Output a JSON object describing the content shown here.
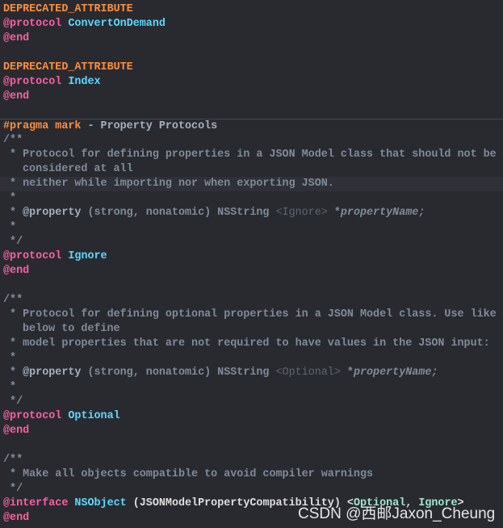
{
  "colors": {
    "background": "#292a30",
    "keyword": "#fc5fa3",
    "type": "#5dd8ff",
    "macro": "#fd8f3f",
    "comment": "#7f8c98"
  },
  "lines": [
    {
      "tokens": [
        {
          "k": "macro",
          "t": "DEPRECATED_ATTRIBUTE"
        }
      ]
    },
    {
      "tokens": [
        {
          "k": "kw",
          "t": "@protocol"
        },
        {
          "k": "plain",
          "t": " "
        },
        {
          "k": "type",
          "t": "ConvertOnDemand"
        }
      ]
    },
    {
      "tokens": [
        {
          "k": "kw",
          "t": "@end"
        }
      ]
    },
    {
      "tokens": []
    },
    {
      "tokens": [
        {
          "k": "macro",
          "t": "DEPRECATED_ATTRIBUTE"
        }
      ]
    },
    {
      "tokens": [
        {
          "k": "kw",
          "t": "@protocol"
        },
        {
          "k": "plain",
          "t": " "
        },
        {
          "k": "type",
          "t": "Index"
        }
      ]
    },
    {
      "tokens": [
        {
          "k": "kw",
          "t": "@end"
        }
      ]
    },
    {
      "tokens": []
    },
    {
      "sep": true,
      "tokens": [
        {
          "k": "macro",
          "t": "#pragma mark"
        },
        {
          "k": "cmb",
          "t": " - Property Protocols"
        }
      ]
    },
    {
      "tokens": [
        {
          "k": "cm",
          "t": "/**"
        }
      ]
    },
    {
      "tokens": [
        {
          "k": "cm",
          "t": " * Protocol for defining properties in a JSON Model class that should not be"
        }
      ]
    },
    {
      "wrap": true,
      "tokens": [
        {
          "k": "cm",
          "t": "considered at all"
        }
      ]
    },
    {
      "hl": true,
      "tokens": [
        {
          "k": "cm",
          "t": " * neither while importing nor when exporting JSON."
        }
      ]
    },
    {
      "tokens": [
        {
          "k": "cm",
          "t": " *"
        }
      ]
    },
    {
      "tokens": [
        {
          "k": "cm",
          "t": " * "
        },
        {
          "k": "cmb",
          "t": "@property"
        },
        {
          "k": "cm",
          "t": " (strong, nonatomic) NSString "
        },
        {
          "k": "tag",
          "t": "<Ignore>"
        },
        {
          "k": "cm",
          "t": " *"
        },
        {
          "k": "cmi",
          "t": "propertyName;"
        }
      ]
    },
    {
      "tokens": [
        {
          "k": "cm",
          "t": " *"
        }
      ]
    },
    {
      "tokens": [
        {
          "k": "cm",
          "t": " */"
        }
      ]
    },
    {
      "tokens": [
        {
          "k": "kw",
          "t": "@protocol"
        },
        {
          "k": "plain",
          "t": " "
        },
        {
          "k": "type",
          "t": "Ignore"
        }
      ]
    },
    {
      "tokens": [
        {
          "k": "kw",
          "t": "@end"
        }
      ]
    },
    {
      "tokens": []
    },
    {
      "tokens": [
        {
          "k": "cm",
          "t": "/**"
        }
      ]
    },
    {
      "tokens": [
        {
          "k": "cm",
          "t": " * Protocol for defining optional properties in a JSON Model class. Use like"
        }
      ]
    },
    {
      "wrap": true,
      "tokens": [
        {
          "k": "cm",
          "t": "below to define"
        }
      ]
    },
    {
      "tokens": [
        {
          "k": "cm",
          "t": " * model properties that are not required to have values in the JSON input:"
        }
      ]
    },
    {
      "tokens": [
        {
          "k": "cm",
          "t": " *"
        }
      ]
    },
    {
      "tokens": [
        {
          "k": "cm",
          "t": " * "
        },
        {
          "k": "cmb",
          "t": "@property"
        },
        {
          "k": "cm",
          "t": " (strong, nonatomic) NSString "
        },
        {
          "k": "tag",
          "t": "<Optional>"
        },
        {
          "k": "cm",
          "t": " *"
        },
        {
          "k": "cmi",
          "t": "propertyName;"
        }
      ]
    },
    {
      "tokens": [
        {
          "k": "cm",
          "t": " *"
        }
      ]
    },
    {
      "tokens": [
        {
          "k": "cm",
          "t": " */"
        }
      ]
    },
    {
      "tokens": [
        {
          "k": "kw",
          "t": "@protocol"
        },
        {
          "k": "plain",
          "t": " "
        },
        {
          "k": "type",
          "t": "Optional"
        }
      ]
    },
    {
      "tokens": [
        {
          "k": "kw",
          "t": "@end"
        }
      ]
    },
    {
      "tokens": []
    },
    {
      "tokens": [
        {
          "k": "cm",
          "t": "/**"
        }
      ]
    },
    {
      "tokens": [
        {
          "k": "cm",
          "t": " * Make all objects compatible to avoid compiler warnings"
        }
      ]
    },
    {
      "tokens": [
        {
          "k": "cm",
          "t": " */"
        }
      ]
    },
    {
      "tokens": [
        {
          "k": "kw",
          "t": "@interface"
        },
        {
          "k": "plain",
          "t": " "
        },
        {
          "k": "type",
          "t": "NSObject"
        },
        {
          "k": "plain",
          "t": " (JSONModelPropertyCompatibility) <"
        },
        {
          "k": "green",
          "t": "Optional"
        },
        {
          "k": "plain",
          "t": ", "
        },
        {
          "k": "green",
          "t": "Ignore"
        },
        {
          "k": "plain",
          "t": ">"
        }
      ]
    },
    {
      "tokens": [
        {
          "k": "kw",
          "t": "@end"
        }
      ]
    }
  ],
  "watermark": "CSDN @西邮Jaxon_Cheung"
}
